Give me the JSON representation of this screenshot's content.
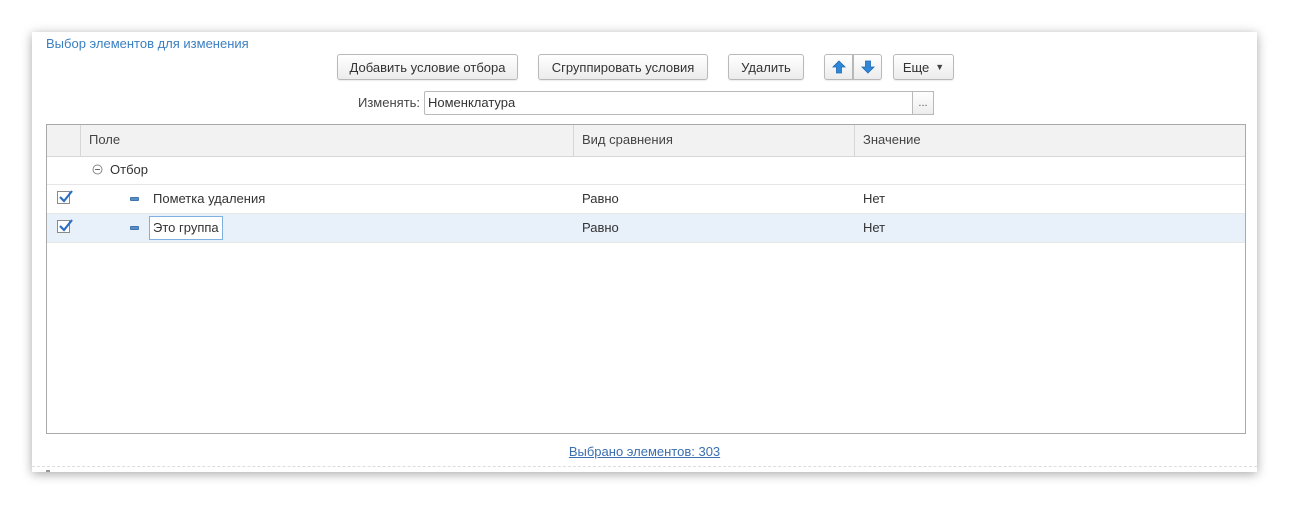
{
  "form": {
    "title": "Выбор элементов для изменения",
    "toolbar": {
      "add_condition": "Добавить условие отбора",
      "group_conditions": "Сгруппировать условия",
      "delete": "Удалить",
      "more": "Еще",
      "up_icon": "arrow-up-icon",
      "down_icon": "arrow-down-icon"
    },
    "change_label": "Изменять:",
    "change_value": "Номенклатура",
    "choose_button": "..."
  },
  "grid": {
    "columns": [
      "Поле",
      "Вид сравнения",
      "Значение"
    ],
    "group": {
      "label": "Отбор",
      "expanded": true
    },
    "rows": [
      {
        "checked": true,
        "field": "Пометка удаления",
        "comparison": "Равно",
        "value": "Нет",
        "selected": false
      },
      {
        "checked": true,
        "field": "Это группа",
        "comparison": "Равно",
        "value": "Нет",
        "selected": true
      }
    ]
  },
  "footer": {
    "selected_link": "Выбрано элементов: 303"
  },
  "colors": {
    "accent": "#3a7fc1",
    "selected_row": "#e8f0fa",
    "arrow": "#2f87d8"
  }
}
